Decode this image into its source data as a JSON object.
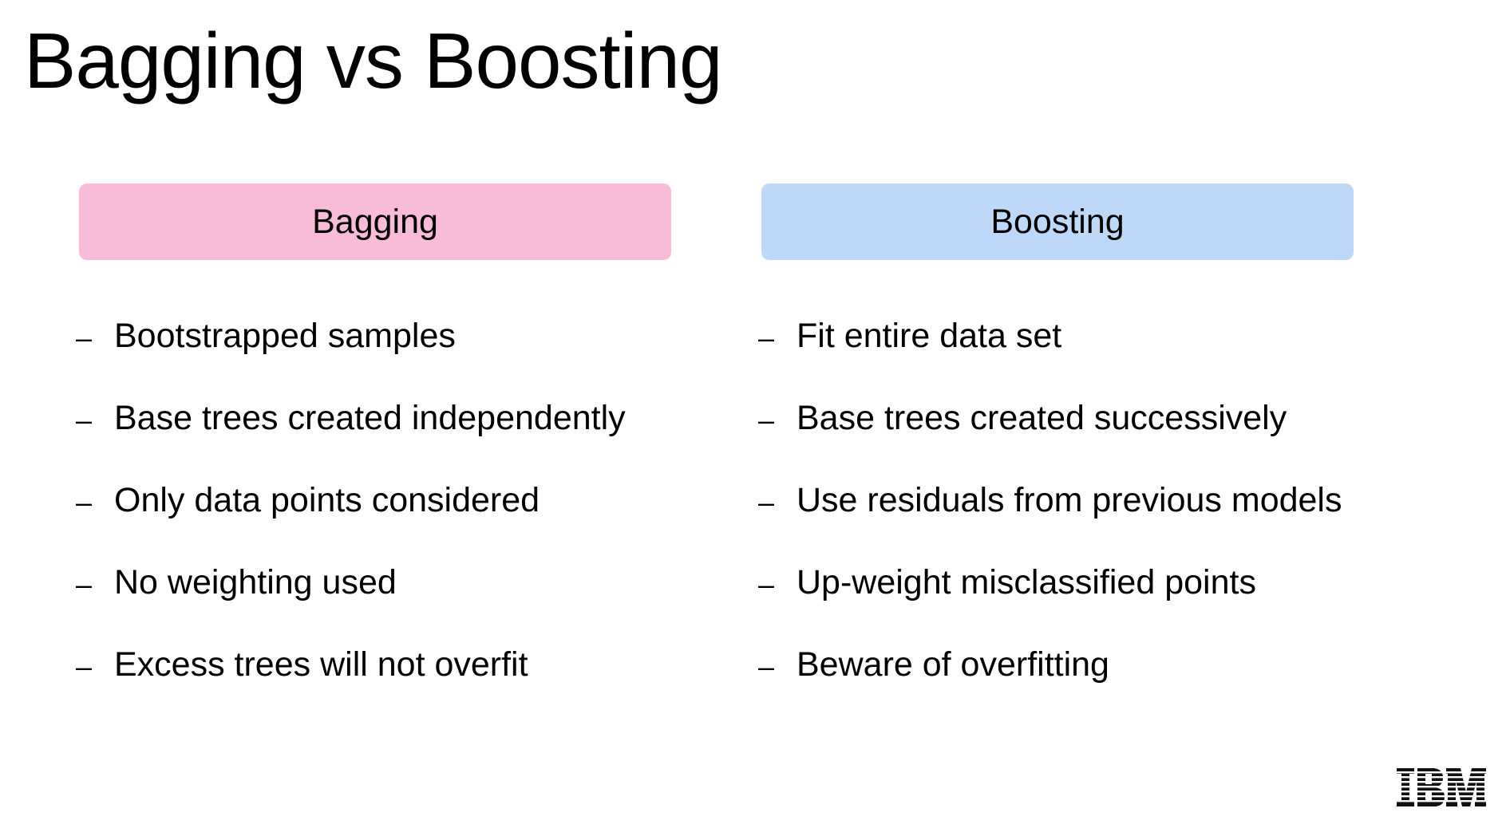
{
  "slide": {
    "title": "Bagging vs Boosting"
  },
  "columns": [
    {
      "header": "Bagging",
      "header_color": "#f8bbd8",
      "bullets": [
        "Bootstrapped samples",
        "Base trees created independently",
        "Only data points considered",
        "No weighting used",
        "Excess trees will not overfit"
      ]
    },
    {
      "header": "Boosting",
      "header_color": "#bed8f7",
      "bullets": [
        "Fit entire data set",
        "Base trees created successively",
        "Use residuals from previous models",
        "Up-weight misclassified points",
        "Beware of overfitting"
      ]
    }
  ],
  "bullet_marker": "–",
  "logo": {
    "text": "IBM",
    "icon": "ibm-logo"
  }
}
